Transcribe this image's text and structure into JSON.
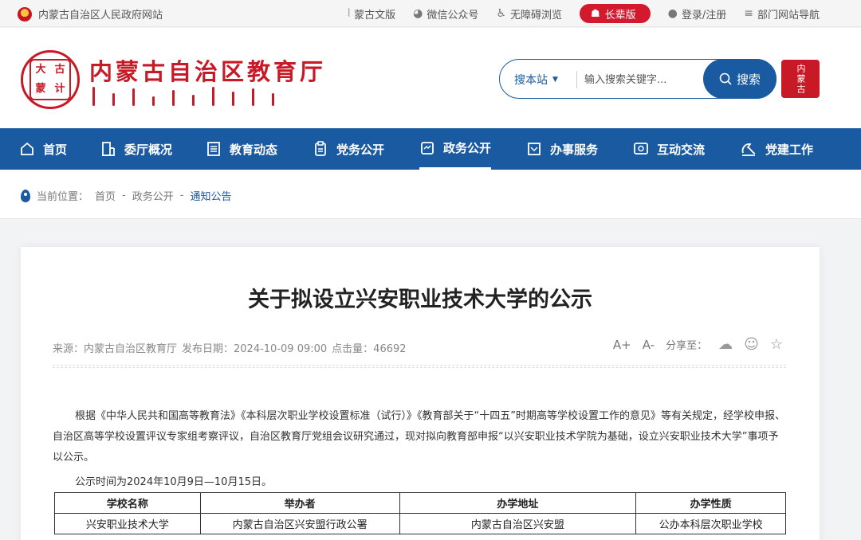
{
  "topbar": {
    "gov_site": "内蒙古自治区人民政府网站",
    "mongolian": "蒙古文版",
    "wechat": "微信公众号",
    "accessible": "无障碍浏览",
    "elder": "长辈版",
    "login": "登录/注册",
    "nav_guide": "部门网站导航"
  },
  "header": {
    "seal_chars": [
      "大",
      "古",
      "蒙",
      "计"
    ],
    "site_title": "内蒙古自治区教育厅",
    "search_scope": "搜本站",
    "search_placeholder": "输入搜索关键字...",
    "search_button": "搜索",
    "mg_badge": "内蒙古"
  },
  "nav": {
    "items": [
      {
        "label": "首页",
        "icon": "home-icon"
      },
      {
        "label": "委厅概况",
        "icon": "building-icon"
      },
      {
        "label": "教育动态",
        "icon": "list-icon"
      },
      {
        "label": "党务公开",
        "icon": "clipboard-icon"
      },
      {
        "label": "政务公开",
        "icon": "document-icon"
      },
      {
        "label": "办事服务",
        "icon": "service-icon"
      },
      {
        "label": "互动交流",
        "icon": "chat-icon"
      },
      {
        "label": "党建工作",
        "icon": "party-icon"
      }
    ]
  },
  "breadcrumb": {
    "prefix": "当前位置：",
    "home": "首页",
    "sep": " - ",
    "section": "政务公开",
    "current": "通知公告"
  },
  "article": {
    "title": "关于拟设立兴安职业技术大学的公示",
    "source": "来源：内蒙古自治区教育厅",
    "date": "发布日期：2024-10-09 09:00",
    "clicks": "点击量：46692",
    "font_up": "A+",
    "font_down": "A-",
    "share_label": "分享至：",
    "body": "根据《中华人民共和国高等教育法》《本科层次职业学校设置标准（试行）》《教育部关于“十四五”时期高等学校设置工作的意见》等有关规定，经学校申报、自治区高等学校设置评议专家组考察评议，自治区教育厅党组会议研究通过，现对拟向教育部申报“以兴安职业技术学院为基础，设立兴安职业技术大学”事项予以公示。",
    "notice_time": "公示时间为2024年10月9日—10月15日。",
    "table": {
      "headers": [
        "学校名称",
        "举办者",
        "办学地址",
        "办学性质"
      ],
      "rows": [
        [
          "兴安职业技术大学",
          "内蒙古自治区兴安盟行政公署",
          "内蒙古自治区兴安盟",
          "公办本科层次职业学校"
        ]
      ]
    }
  }
}
